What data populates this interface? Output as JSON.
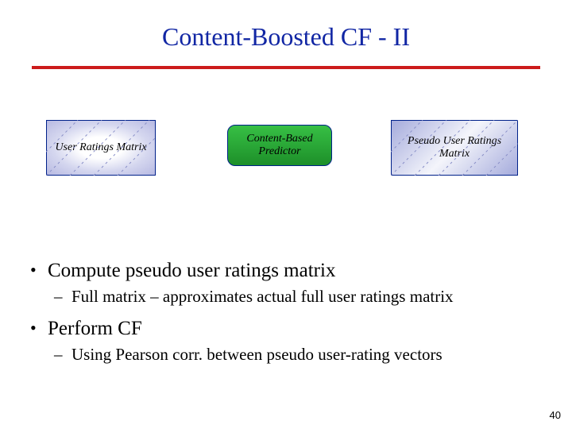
{
  "title": "Content-Boosted CF - II",
  "colors": {
    "title": "#1126a4",
    "rule": "#cc1b1b"
  },
  "diagram": {
    "left": {
      "name": "user-ratings-matrix",
      "label": "User Ratings\nMatrix"
    },
    "center": {
      "name": "content-based-predictor",
      "label": "Content-Based\nPredictor"
    },
    "right": {
      "name": "pseudo-user-ratings-matrix",
      "label": "Pseudo User\nRatings Matrix"
    }
  },
  "bullets": [
    {
      "text": "Compute pseudo user ratings matrix",
      "sub": "Full matrix – approximates actual full user ratings matrix"
    },
    {
      "text": "Perform CF",
      "sub": "Using Pearson corr. between pseudo user-rating vectors"
    }
  ],
  "page_number": "40"
}
